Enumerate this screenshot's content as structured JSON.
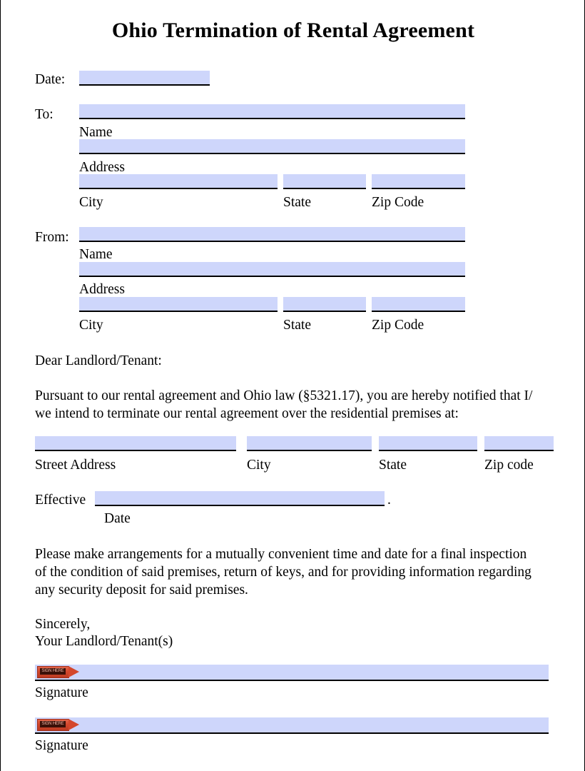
{
  "document": {
    "title": "Ohio Termination of Rental Agreement"
  },
  "date_row": {
    "label": "Date:",
    "field_value": ""
  },
  "to_block": {
    "label": "To:",
    "name_value": "",
    "name_caption": "Name",
    "address_value": "",
    "address_caption": "Address",
    "city_value": "",
    "city_caption": "City",
    "state_value": "",
    "state_caption": "State",
    "zip_value": "",
    "zip_caption": "Zip Code"
  },
  "from_block": {
    "label": "From:",
    "name_value": "",
    "name_caption": "Name",
    "address_value": "",
    "address_caption": "Address",
    "city_value": "",
    "city_caption": "City",
    "state_value": "",
    "state_caption": "State",
    "zip_value": "",
    "zip_caption": "Zip Code"
  },
  "body": {
    "salutation": "Dear Landlord/Tenant:",
    "paragraph_1_line_1": "Pursuant to our rental agreement and Ohio law (§5321.17), you are hereby notified that I/",
    "paragraph_1_line_2": "we intend to terminate our rental agreement over the residential premises at:",
    "paragraph_2_line_1": "Please make arrangements for a mutually convenient time and date for a final inspection",
    "paragraph_2_line_2": "of the condition of said premises, return of keys, and for providing information regarding",
    "paragraph_2_line_3": "any security deposit for said premises.",
    "closing_line_1": "Sincerely,",
    "closing_line_2": "Your Landlord/Tenant(s)"
  },
  "premises": {
    "street_value": "",
    "street_caption": "Street Address",
    "city_value": "",
    "city_caption": "City",
    "state_value": "",
    "state_caption": "State",
    "zip_value": "",
    "zip_caption": "Zip code"
  },
  "effective": {
    "label": "Effective",
    "field_value": "",
    "period": ".",
    "caption": "Date"
  },
  "signatures": [
    {
      "tag_text": "SIGN HERE",
      "value": "",
      "caption": "Signature"
    },
    {
      "tag_text": "SIGN HERE",
      "value": "",
      "caption": "Signature"
    }
  ],
  "colors": {
    "field_fill": "#ced6fb",
    "rule": "#000000",
    "sign_tag": "#d4472c",
    "text": "#000000"
  }
}
